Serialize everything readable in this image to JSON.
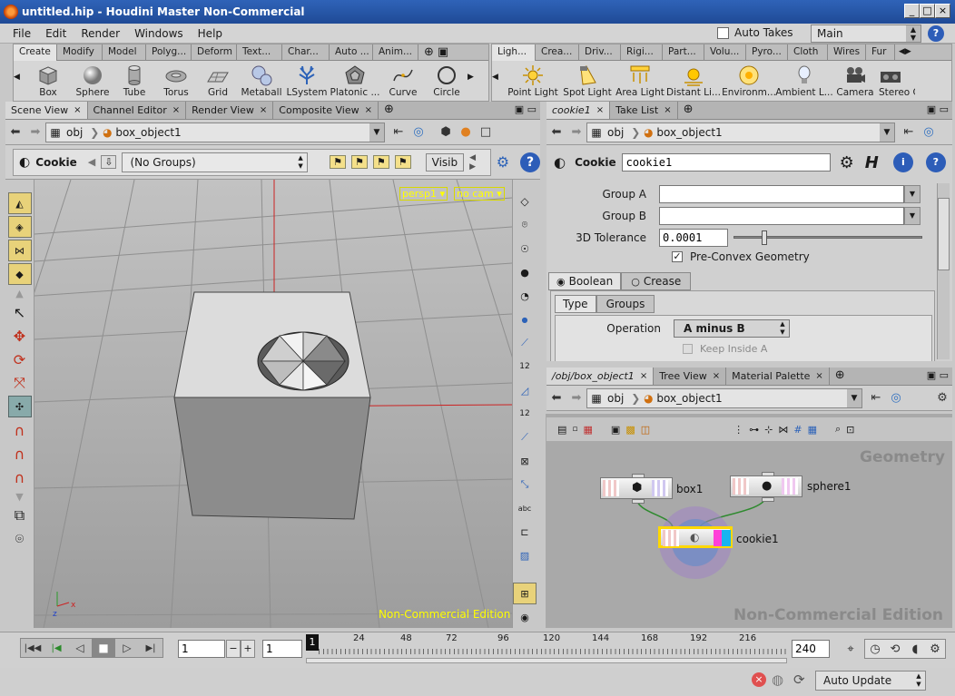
{
  "window": {
    "title": "untitled.hip - Houdini Master Non-Commercial"
  },
  "menubar": {
    "items": [
      "File",
      "Edit",
      "Render",
      "Windows",
      "Help"
    ],
    "auto_takes_label": "Auto Takes",
    "desktop_value": "Main"
  },
  "shelf_left": {
    "tabs": [
      "Create",
      "Modify",
      "Model",
      "Polyg...",
      "Deform",
      "Text...",
      "Char...",
      "Auto ...",
      "Anim..."
    ],
    "tools": [
      "Box",
      "Sphere",
      "Tube",
      "Torus",
      "Grid",
      "Metaball",
      "LSystem",
      "Platonic ...",
      "Curve",
      "Circle"
    ]
  },
  "shelf_right": {
    "tabs": [
      "Ligh...",
      "Crea...",
      "Driv...",
      "Rigi...",
      "Part...",
      "Volu...",
      "Pyro...",
      "Cloth",
      "Wires",
      "Fur"
    ],
    "tools": [
      "Point Light",
      "Spot Light",
      "Area Light",
      "Distant Li...",
      "Environm...",
      "Ambient L...",
      "Camera",
      "Stereo C"
    ]
  },
  "scene_pane": {
    "tabs": [
      "Scene View",
      "Channel Editor",
      "Render View",
      "Composite View"
    ],
    "path_root": "obj",
    "path_node": "box_object1",
    "op_label": "Cookie",
    "group_value": "(No Groups)",
    "visib_label": "Visib",
    "persp_label": "persp1",
    "cam_label": "no cam",
    "watermark": "Non-Commercial Edition",
    "side_numbers": [
      "12",
      "12"
    ],
    "side_abc": "abc"
  },
  "parm_pane": {
    "tabs": [
      "cookie1",
      "Take List"
    ],
    "path_root": "obj",
    "path_node": "box_object1",
    "op_label": "Cookie",
    "node_name": "cookie1",
    "group_a_label": "Group A",
    "group_b_label": "Group B",
    "tolerance_label": "3D Tolerance",
    "tolerance_value": "0.0001",
    "tolerance_slider": 0.15,
    "preconvex_label": "Pre-Convex Geometry",
    "mode_tabs": [
      "Boolean",
      "Crease"
    ],
    "sub_tabs": [
      "Type",
      "Groups"
    ],
    "operation_label": "Operation",
    "operation_value": "A minus B",
    "keep_inside_label": "Keep Inside A"
  },
  "network_pane": {
    "tabs": [
      "/obj/box_object1",
      "Tree View",
      "Material Palette"
    ],
    "path_root": "obj",
    "path_node": "box_object1",
    "context_label": "Geometry",
    "watermark": "Non-Commercial Edition",
    "nodes": [
      "box1",
      "sphere1",
      "cookie1"
    ]
  },
  "timeline": {
    "current_frame": "1",
    "start_frame": "1",
    "end_frame": "240",
    "marker": "1",
    "ticks": [
      "24",
      "48",
      "72",
      "96",
      "120",
      "144",
      "168",
      "192",
      "216"
    ]
  },
  "statusbar": {
    "update_mode": "Auto Update"
  },
  "colors": {
    "titlebar": "#2a5bad",
    "watermark": "#ffff00",
    "selected_node": "#ffd800"
  }
}
